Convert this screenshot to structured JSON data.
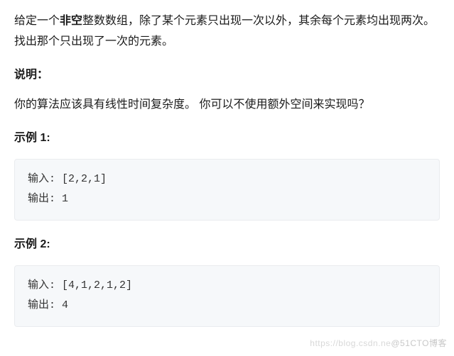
{
  "intro": {
    "text_before_bold": "给定一个",
    "bold_word": "非空",
    "text_after_bold": "整数数组，除了某个元素只出现一次以外，其余每个元素均出现两次。找出那个只出现了一次的元素。"
  },
  "note": {
    "heading": "说明：",
    "text": "你的算法应该具有线性时间复杂度。 你可以不使用额外空间来实现吗？"
  },
  "examples": [
    {
      "heading": "示例 1:",
      "input_label": "输入: ",
      "input_value": "[2,2,1]",
      "output_label": "输出: ",
      "output_value": "1"
    },
    {
      "heading": "示例 2:",
      "input_label": "输入: ",
      "input_value": "[4,1,2,1,2]",
      "output_label": "输出: ",
      "output_value": "4"
    }
  ],
  "watermark": {
    "faint": "https://blog.csdn.ne",
    "brand": "@51CTO博客"
  }
}
